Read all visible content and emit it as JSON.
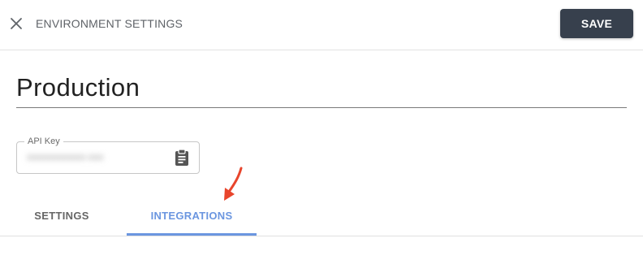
{
  "header": {
    "title": "ENVIRONMENT SETTINGS",
    "close_icon": "close-icon",
    "save_label": "SAVE",
    "save_color": "#37404d"
  },
  "environment": {
    "name": "Production"
  },
  "api_key": {
    "label": "API Key",
    "value": "xxxxxxxxxxxx-xxxx",
    "copy_icon": "clipboard-icon"
  },
  "tabs": [
    {
      "label": "SETTINGS",
      "active": false
    },
    {
      "label": "INTEGRATIONS",
      "active": true
    }
  ],
  "colors": {
    "accent": "#6b96e0",
    "annotation": "#e8452c"
  }
}
